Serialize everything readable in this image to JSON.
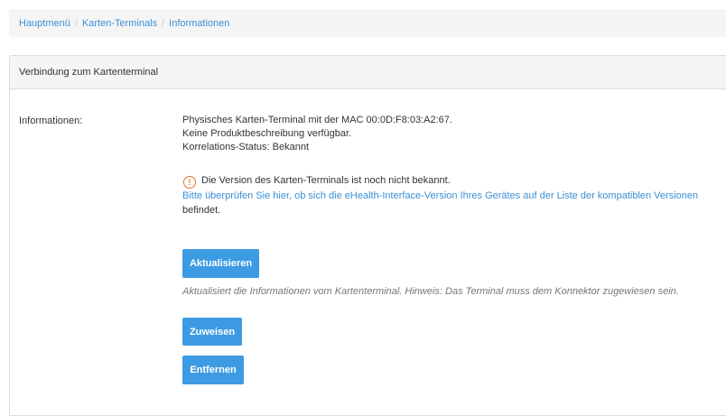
{
  "breadcrumb": {
    "items": [
      "Hauptmenü",
      "Karten-Terminals",
      "Informationen"
    ],
    "separator": "/"
  },
  "panel": {
    "title": "Verbindung zum Kartenterminal",
    "info_label": "Informationen:",
    "info_lines": [
      "Physisches Karten-Terminal mit der MAC 00:0D:F8:03:A2:67.",
      "Keine Produktbeschreibung verfügbar.",
      "Korrelations-Status: Bekannt"
    ],
    "warning": {
      "icon": "exclamation-circle-icon",
      "text": "Die Version des Karten-Terminals ist noch nicht bekannt.",
      "link_text": "Bitte überprüfen Sie hier, ob sich die eHealth-Interface-Version Ihres Gerätes auf der Liste der kompatiblen Versionen",
      "suffix": "befindet."
    },
    "buttons": {
      "update": "Aktualisieren",
      "assign": "Zuweisen",
      "remove": "Entfernen"
    },
    "update_hint": "Aktualisiert die Informationen vom Kartenterminal. Hinweis: Das Terminal muss dem Konnektor zugewiesen sein."
  },
  "colors": {
    "accent": "#3d9be3",
    "link": "#3a8fd6",
    "warning": "#e0742b"
  }
}
